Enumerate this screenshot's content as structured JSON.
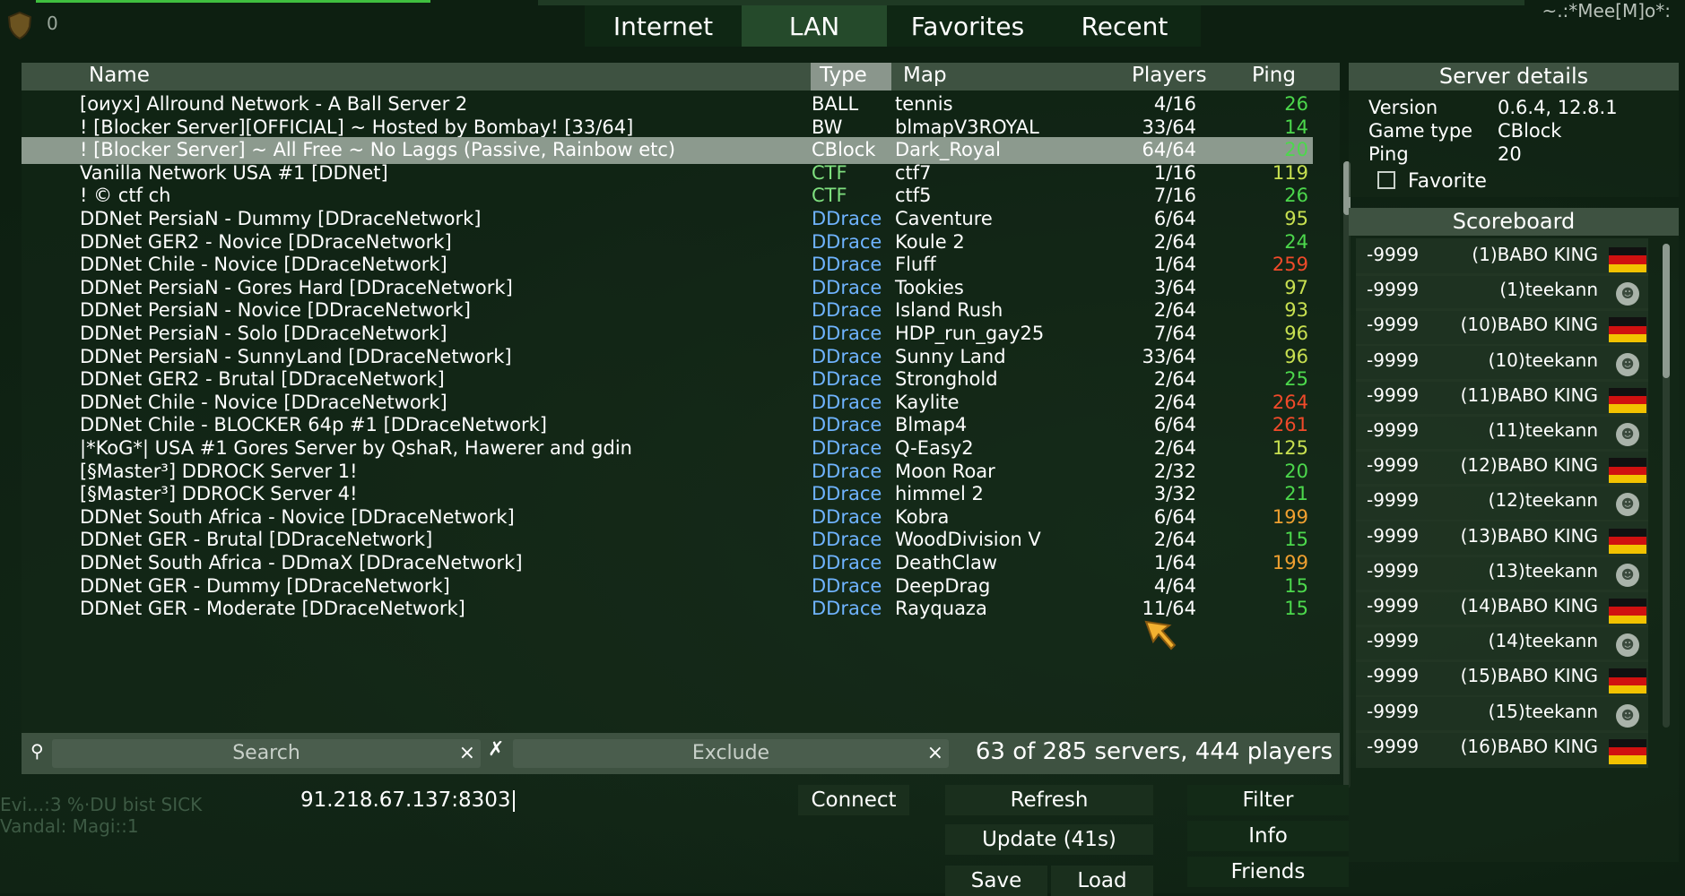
{
  "hud": {
    "score": "0",
    "player_tag": "~.:*Mee[M]o*:"
  },
  "tabs": [
    {
      "label": "Internet",
      "active": false
    },
    {
      "label": "LAN",
      "active": true
    },
    {
      "label": "Favorites",
      "active": false
    },
    {
      "label": "Recent",
      "active": false
    }
  ],
  "columns": {
    "name": "Name",
    "type": "Type",
    "map": "Map",
    "players": "Players",
    "ping": "Ping"
  },
  "colors": {
    "ball": "#ffffff",
    "ctf": "#7fe07f",
    "ddrace": "#6fb3ff",
    "ping_good": "#4cd84c",
    "ping_ok": "#c8e050",
    "ping_fair": "#f0a030",
    "ping_bad": "#f04a2a"
  },
  "servers": [
    {
      "name": "[оиух] Allround Network - A Ball Server 2",
      "type": "BALL",
      "map": "tennis",
      "players": "4/16",
      "ping": "26"
    },
    {
      "name": "!      [Blocker Server][OFFICIAL] ~ Hosted by Bombay! [33/64]",
      "type": "BW",
      "map": "blmapV3ROYAL",
      "players": "33/64",
      "ping": "14"
    },
    {
      "name": "! [Blocker Server] ~ All Free ~ No Laggs (Passive, Rainbow etc)",
      "type": "CBlock",
      "map": "Dark_Royal",
      "players": "64/64",
      "ping": "20"
    },
    {
      "name": "Vanilla Network USA #1 [DDNet]",
      "type": "CTF",
      "map": "ctf7",
      "players": "1/16",
      "ping": "119"
    },
    {
      "name": "!                                    © ctf ch",
      "type": "CTF",
      "map": "ctf5",
      "players": "7/16",
      "ping": "26"
    },
    {
      "name": "DDNet PersiaN - Dummy [DDraceNetwork]",
      "type": "DDrace",
      "map": "Caventure",
      "players": "6/64",
      "ping": "95"
    },
    {
      "name": "DDNet GER2 - Novice [DDraceNetwork]",
      "type": "DDrace",
      "map": "Koule 2",
      "players": "2/64",
      "ping": "24"
    },
    {
      "name": "DDNet Chile - Novice [DDraceNetwork]",
      "type": "DDrace",
      "map": "Fluff",
      "players": "1/64",
      "ping": "259"
    },
    {
      "name": "DDNet PersiaN - Gores Hard [DDraceNetwork]",
      "type": "DDrace",
      "map": "Tookies",
      "players": "3/64",
      "ping": "97"
    },
    {
      "name": "DDNet PersiaN - Novice [DDraceNetwork]",
      "type": "DDrace",
      "map": "Island Rush",
      "players": "2/64",
      "ping": "93"
    },
    {
      "name": "DDNet PersiaN - Solo [DDraceNetwork]",
      "type": "DDrace",
      "map": "HDP_run_gay25",
      "players": "7/64",
      "ping": "96"
    },
    {
      "name": "DDNet PersiaN - SunnyLand [DDraceNetwork]",
      "type": "DDrace",
      "map": "Sunny Land",
      "players": "33/64",
      "ping": "96"
    },
    {
      "name": "DDNet GER2 - Brutal [DDraceNetwork]",
      "type": "DDrace",
      "map": "Stronghold",
      "players": "2/64",
      "ping": "25"
    },
    {
      "name": "DDNet Chile - Novice [DDraceNetwork]",
      "type": "DDrace",
      "map": "Kaylite",
      "players": "2/64",
      "ping": "264"
    },
    {
      "name": "DDNet Chile - BLOCKER 64p #1 [DDraceNetwork]",
      "type": "DDrace",
      "map": "Blmap4",
      "players": "6/64",
      "ping": "261"
    },
    {
      "name": "|*KoG*| USA #1 Gores Server by QshaR, Hawerer and gdin",
      "type": "DDrace",
      "map": "Q-Easy2",
      "players": "2/64",
      "ping": "125"
    },
    {
      "name": "[§Master³] DDROCK Server 1!",
      "type": "DDrace",
      "map": "Moon Roar",
      "players": "2/32",
      "ping": "20"
    },
    {
      "name": "[§Master³] DDROCK Server 4!",
      "type": "DDrace",
      "map": "himmel 2",
      "players": "3/32",
      "ping": "21"
    },
    {
      "name": "DDNet South Africa - Novice [DDraceNetwork]",
      "type": "DDrace",
      "map": "Kobra",
      "players": "6/64",
      "ping": "199"
    },
    {
      "name": "DDNet GER - Brutal [DDraceNetwork]",
      "type": "DDrace",
      "map": "WoodDivision V",
      "players": "2/64",
      "ping": "15"
    },
    {
      "name": "DDNet South Africa - DDmaX [DDraceNetwork]",
      "type": "DDrace",
      "map": "DeathClaw",
      "players": "1/64",
      "ping": "199"
    },
    {
      "name": "DDNet GER - Dummy [DDraceNetwork]",
      "type": "DDrace",
      "map": "DeepDrag",
      "players": "4/64",
      "ping": "15"
    },
    {
      "name": "DDNet GER - Moderate [DDraceNetwork]",
      "type": "DDrace",
      "map": "Rayquaza",
      "players": "11/64",
      "ping": "15"
    }
  ],
  "selected_index": 2,
  "filter": {
    "search_placeholder": "Search",
    "exclude_placeholder": "Exclude",
    "clear_glyph": "×",
    "exclude_glyph": "✗",
    "search_glyph": "⚲",
    "summary": "63 of 285 servers, 444 players"
  },
  "bottom": {
    "address": "91.218.67.137:8303",
    "connect": "Connect",
    "refresh": "Refresh",
    "update": "Update (41s)",
    "save": "Save",
    "load": "Load",
    "filter": "Filter",
    "info": "Info",
    "friends": "Friends"
  },
  "details": {
    "title": "Server details",
    "version_label": "Version",
    "version": "0.6.4, 12.8.1",
    "gametype_label": "Game type",
    "gametype": "CBlock",
    "ping_label": "Ping",
    "ping": "20",
    "favorite_label": "Favorite"
  },
  "scoreboard": {
    "title": "Scoreboard",
    "entries": [
      {
        "score": "-9999",
        "name": "(1)BABO KING",
        "icon": "flag-germany"
      },
      {
        "score": "-9999",
        "name": "(1)teekann",
        "icon": "default-tee"
      },
      {
        "score": "-9999",
        "name": "(10)BABO KING",
        "icon": "flag-germany"
      },
      {
        "score": "-9999",
        "name": "(10)teekann",
        "icon": "default-tee"
      },
      {
        "score": "-9999",
        "name": "(11)BABO KING",
        "icon": "flag-germany"
      },
      {
        "score": "-9999",
        "name": "(11)teekann",
        "icon": "default-tee"
      },
      {
        "score": "-9999",
        "name": "(12)BABO KING",
        "icon": "flag-germany"
      },
      {
        "score": "-9999",
        "name": "(12)teekann",
        "icon": "default-tee"
      },
      {
        "score": "-9999",
        "name": "(13)BABO KING",
        "icon": "flag-germany"
      },
      {
        "score": "-9999",
        "name": "(13)teekann",
        "icon": "default-tee"
      },
      {
        "score": "-9999",
        "name": "(14)BABO KING",
        "icon": "flag-germany"
      },
      {
        "score": "-9999",
        "name": "(14)teekann",
        "icon": "default-tee"
      },
      {
        "score": "-9999",
        "name": "(15)BABO KING",
        "icon": "flag-germany"
      },
      {
        "score": "-9999",
        "name": "(15)teekann",
        "icon": "default-tee"
      },
      {
        "score": "-9999",
        "name": "(16)BABO KING",
        "icon": "flag-germany"
      }
    ]
  },
  "chat": {
    "line1": "Evi...:3 %·DU bist SICK",
    "line2": "Vandal: Magi::1"
  }
}
